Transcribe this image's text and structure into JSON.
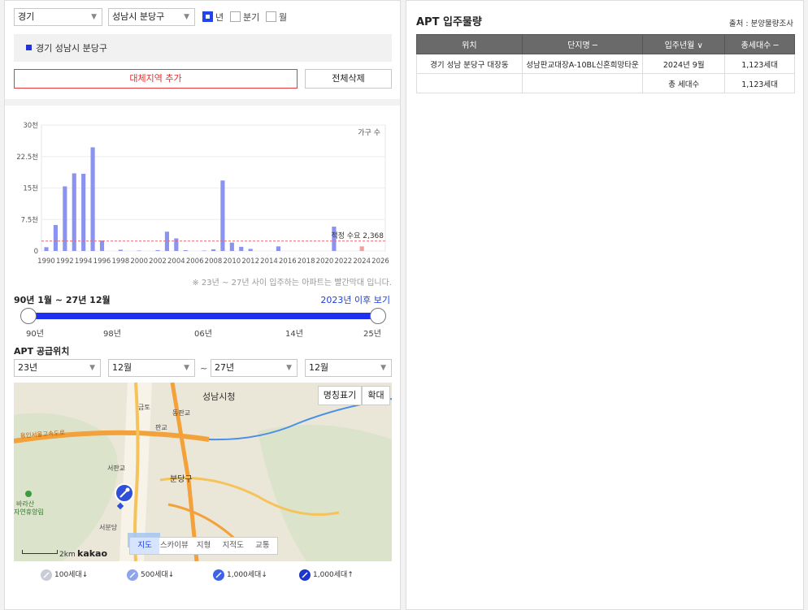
{
  "filters": {
    "province": "경기",
    "city": "성남시 분당구",
    "period_options": [
      {
        "label": "년",
        "checked": true
      },
      {
        "label": "분기",
        "checked": false
      },
      {
        "label": "월",
        "checked": false
      }
    ]
  },
  "selected_region": "경기 성남시 분당구",
  "buttons": {
    "add_alt_region": "대체지역 추가",
    "delete_all": "전체삭제"
  },
  "chart_data": {
    "type": "bar",
    "unit_label": "가구 수",
    "y_ticks": [
      "30천",
      "22.5천",
      "15천",
      "7.5천",
      "0"
    ],
    "ylim": [
      0,
      30000
    ],
    "x_ticks": [
      "1990",
      "1992",
      "1994",
      "1996",
      "1998",
      "2000",
      "2002",
      "2004",
      "2006",
      "2008",
      "2010",
      "2012",
      "2014",
      "2016",
      "2018",
      "2020",
      "2022",
      "2024",
      "2026"
    ],
    "x": [
      1990,
      1991,
      1992,
      1993,
      1994,
      1995,
      1996,
      1997,
      1998,
      1999,
      2000,
      2001,
      2002,
      2003,
      2004,
      2005,
      2006,
      2007,
      2008,
      2009,
      2010,
      2011,
      2012,
      2013,
      2014,
      2015,
      2016,
      2017,
      2018,
      2019,
      2020,
      2021,
      2022,
      2023,
      2024,
      2025,
      2026
    ],
    "values": [
      900,
      6200,
      15400,
      18500,
      18400,
      24700,
      2500,
      0,
      300,
      0,
      100,
      0,
      200,
      4600,
      3000,
      200,
      0,
      100,
      400,
      16800,
      2000,
      1000,
      500,
      0,
      0,
      1100,
      0,
      0,
      0,
      0,
      0,
      5800,
      0,
      0,
      1100,
      0,
      0
    ],
    "highlight_from": 2023,
    "reference_line": {
      "value": 2368,
      "label": "적정 수요 2,368"
    },
    "bar_color": "#8a93f0",
    "highlight_color": "#f0a0a0",
    "reference_color": "#ee6666"
  },
  "chart_note": "※ 23년 ~ 27년 사이 입주하는 아파트는 빨간막대 입니다.",
  "range": {
    "label": "90년 1월 ~ 27년 12월",
    "after_link": "2023년 이후 보기",
    "ticks": [
      "90년",
      "98년",
      "06년",
      "14년",
      "25년"
    ]
  },
  "supply": {
    "title": "APT 공급위치",
    "from_year": "23년",
    "from_month": "12월",
    "tilde": "~",
    "to_year": "27년",
    "to_month": "12월"
  },
  "map": {
    "btn_names": "명칭표기",
    "btn_zoom": "확대",
    "labels": {
      "city_hall": "성남시청",
      "geumto": "금토",
      "dongpan": "동판교",
      "pangyo": "판교",
      "expressway": "용인서울고속도로",
      "seopangyo": "서판교",
      "bundang": "분당구",
      "barasan": "바라산",
      "forest": "자연휴양림",
      "seobundang": "서분당"
    },
    "types": [
      "지도",
      "스카이뷰",
      "지형",
      "지적도",
      "교통"
    ],
    "scale": "2km",
    "brand": "kakao"
  },
  "legend": [
    "100세대↓",
    "500세대↓",
    "1,000세대↓",
    "1,000세대↑"
  ],
  "right": {
    "title": "APT 입주물량",
    "source": "출처 : 분양물량조사",
    "columns": [
      "위치",
      "단지명 ─",
      "입주년월 ∨",
      "총세대수 ─"
    ],
    "rows": [
      [
        "경기 성남 분당구 대장동",
        "성남판교대장A-10BL신혼희망타운",
        "2024년 9월",
        "1,123세대"
      ],
      [
        "",
        "",
        "총 세대수",
        "1,123세대"
      ]
    ]
  },
  "colors": {
    "accent": "#1d31ee",
    "red": "#e52b2b"
  }
}
